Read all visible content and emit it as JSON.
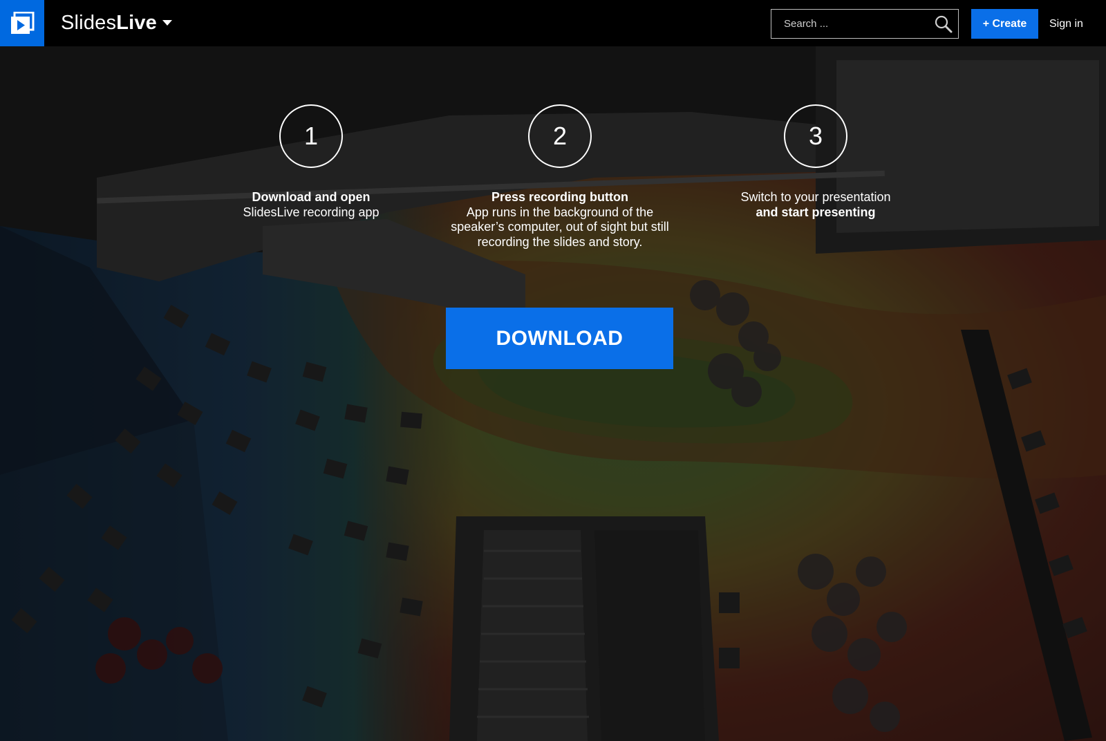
{
  "header": {
    "brand_light": "Slides",
    "brand_bold": "Live",
    "search_placeholder": "Search ...",
    "create_label": "+ Create",
    "signin_label": "Sign in"
  },
  "steps": [
    {
      "number": "1",
      "bold": "Download and open",
      "text": "SlidesLive recording app"
    },
    {
      "number": "2",
      "bold": "Press recording button",
      "text": "App runs in the background of the speaker’s computer, out of sight but still recording the slides and story."
    },
    {
      "number": "3",
      "text": "Switch to your presentation",
      "bold": "and start presenting"
    }
  ],
  "download_label": "DOWNLOAD",
  "colors": {
    "accent": "#0a6fe8",
    "logo_bg": "#0069e0",
    "topbar_bg": "#000000"
  },
  "icons": {
    "logo": "play-slides-icon",
    "caret": "chevron-down-icon",
    "search": "search-icon"
  }
}
